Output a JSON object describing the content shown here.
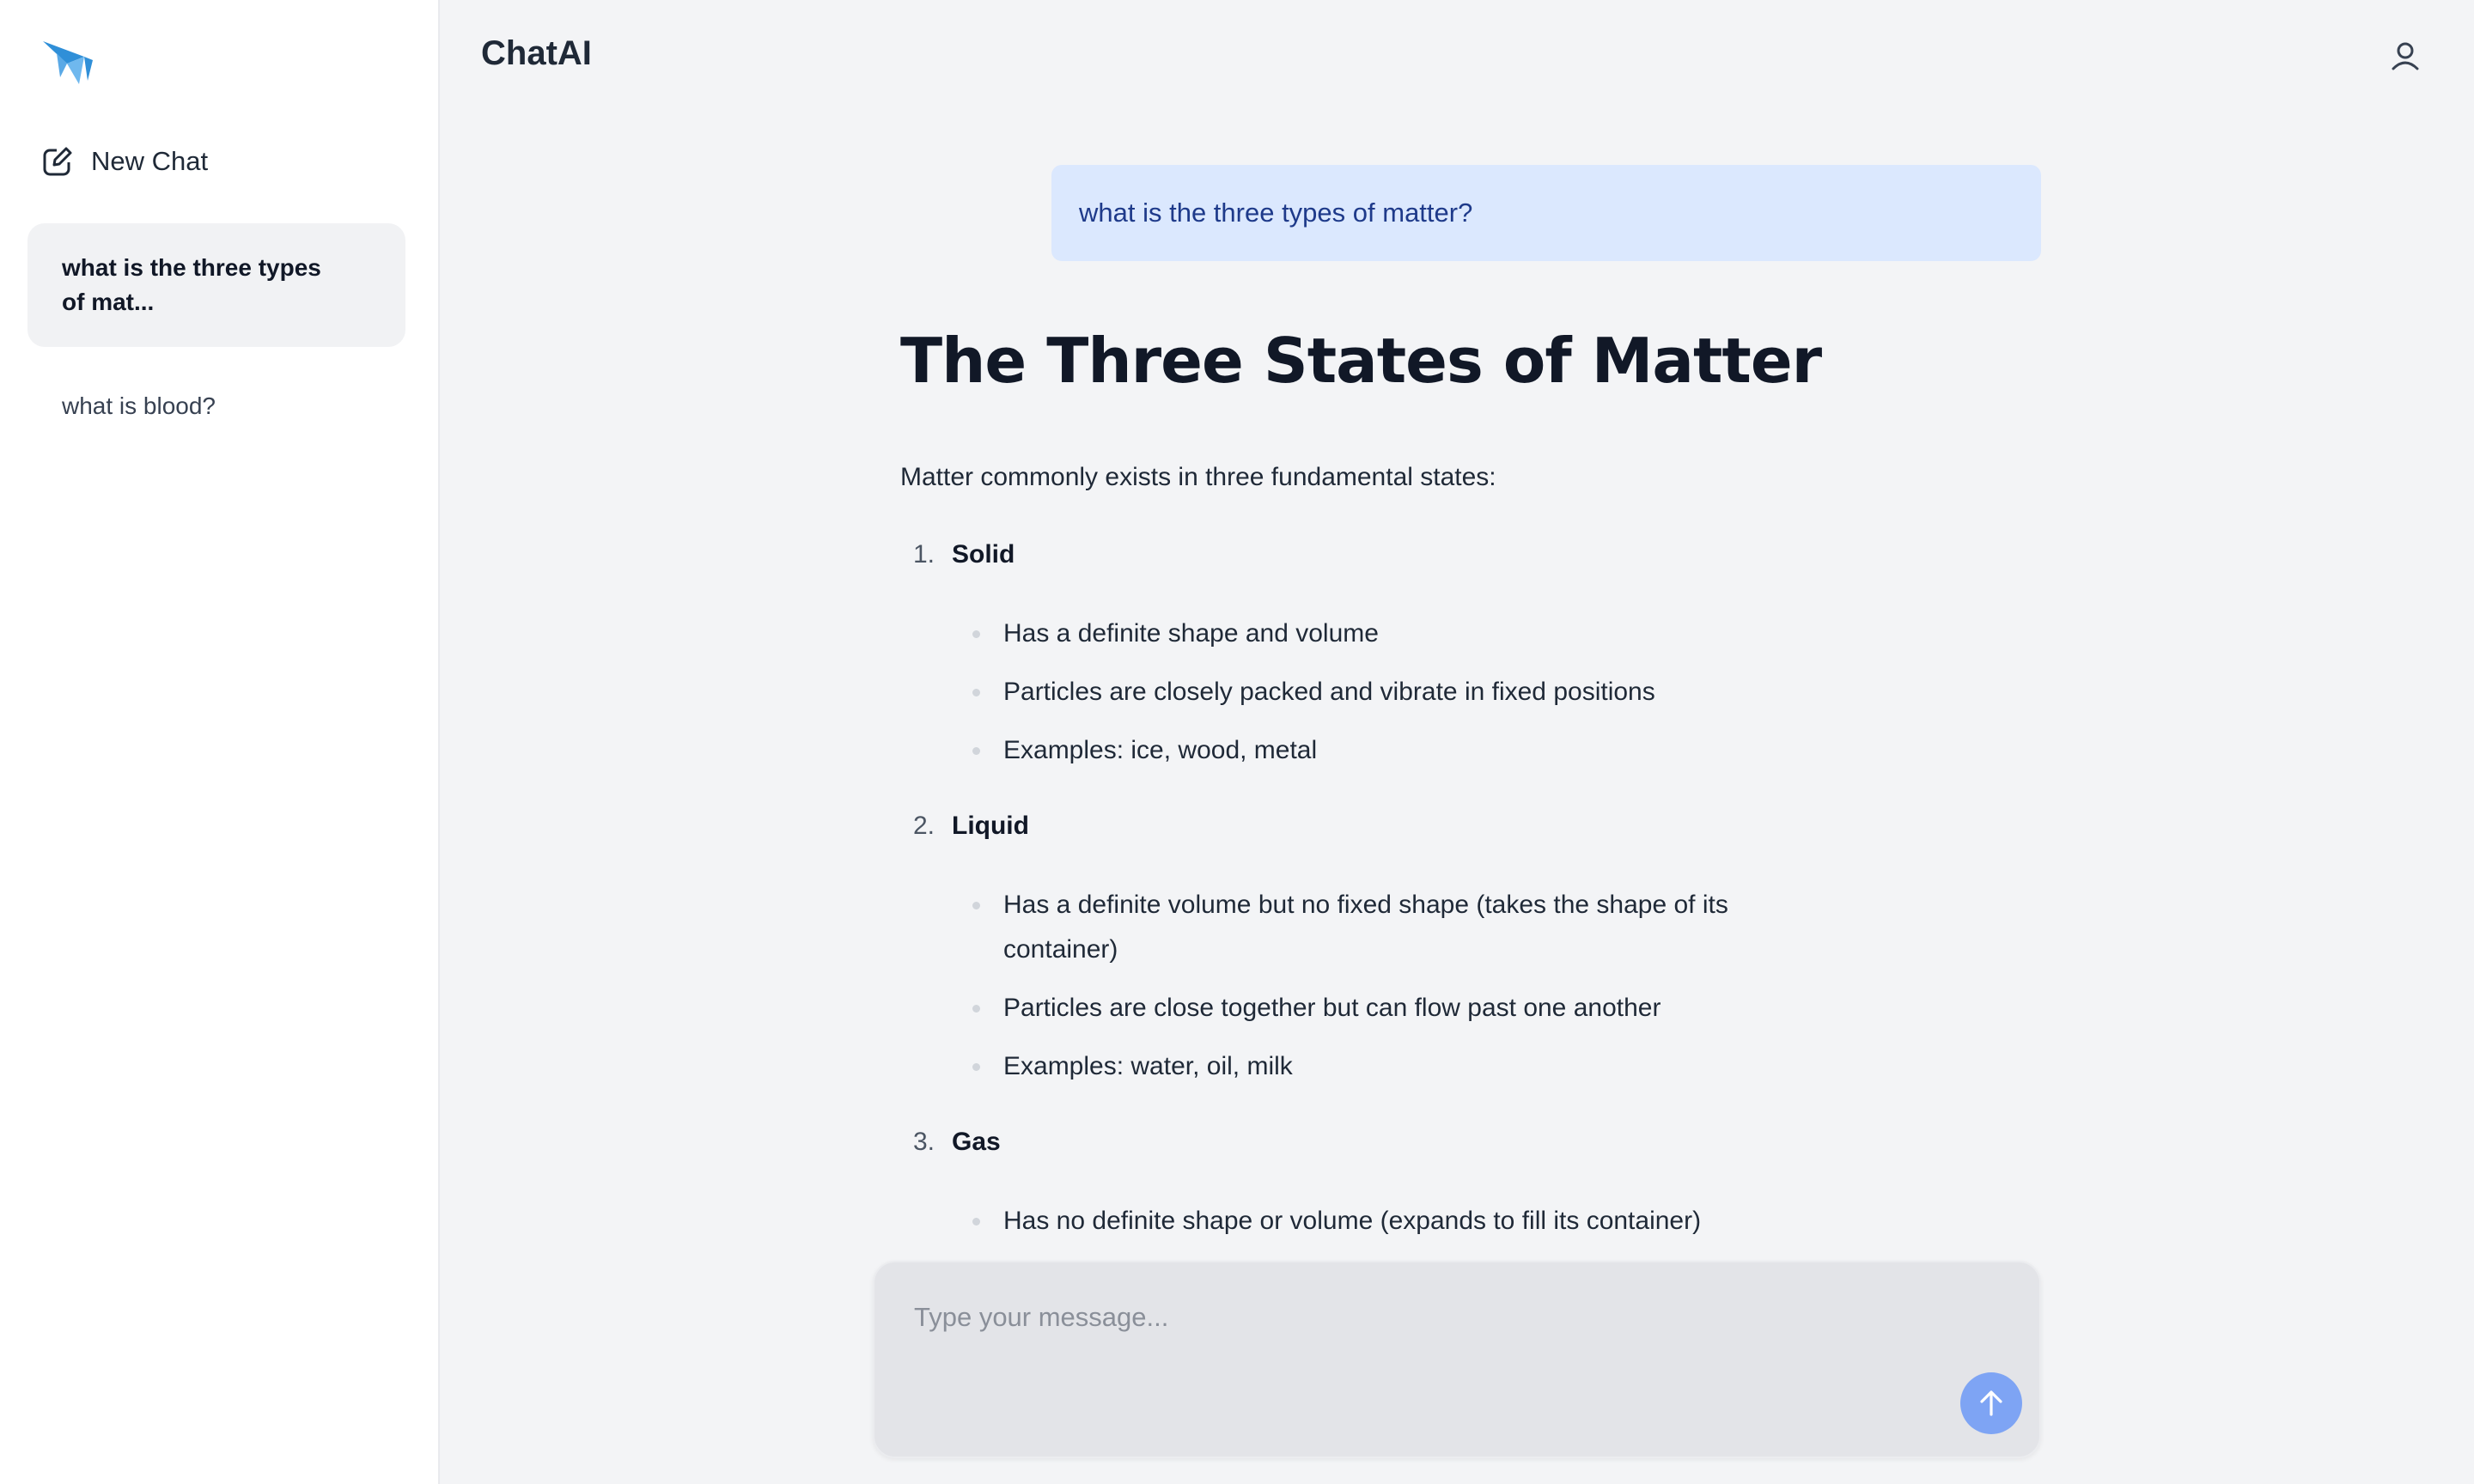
{
  "app": {
    "title": "ChatAI"
  },
  "sidebar": {
    "new_chat_label": "New Chat",
    "history": [
      {
        "label": "what is the three types of mat...",
        "active": true
      },
      {
        "label": "what is blood?",
        "active": false
      }
    ]
  },
  "conversation": {
    "user_message": "what is the three types of matter?",
    "answer": {
      "heading": "The Three States of Matter",
      "intro": "Matter commonly exists in three fundamental states:",
      "sections": [
        {
          "number": "1.",
          "name": "Solid",
          "points": [
            "Has a definite shape and volume",
            "Particles are closely packed and vibrate in fixed positions",
            "Examples: ice, wood, metal"
          ]
        },
        {
          "number": "2.",
          "name": "Liquid",
          "points": [
            "Has a definite volume but no fixed shape (takes the shape of its container)",
            "Particles are close together but can flow past one another",
            "Examples: water, oil, milk"
          ]
        },
        {
          "number": "3.",
          "name": "Gas",
          "points": [
            "Has no definite shape or volume (expands to fill its container)"
          ]
        }
      ]
    }
  },
  "composer": {
    "placeholder": "Type your message...",
    "value": ""
  },
  "icons": {
    "logo": "paper-plane-logo",
    "new_chat": "compose-icon",
    "user": "user-icon",
    "send": "arrow-up-icon"
  },
  "colors": {
    "accent": "#7ea4f4",
    "user_bubble": "#dbe8fe",
    "logo_primary": "#2f8fd8",
    "logo_secondary": "#6fb8ee"
  }
}
